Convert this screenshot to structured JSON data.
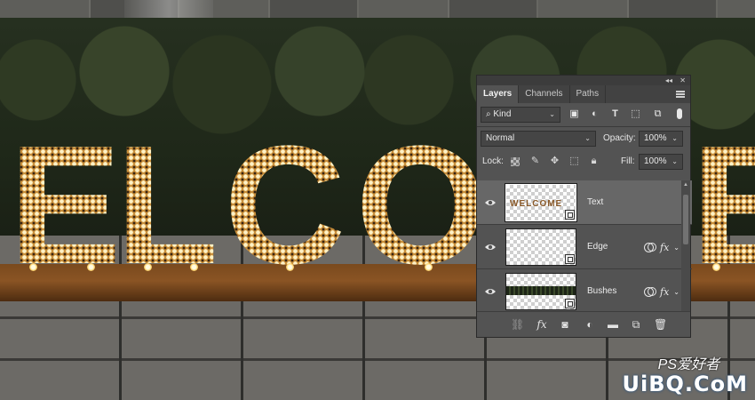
{
  "panel": {
    "tabs": [
      {
        "label": "Layers",
        "active": true
      },
      {
        "label": "Channels",
        "active": false
      },
      {
        "label": "Paths",
        "active": false
      }
    ],
    "filter": {
      "value": "Kind"
    },
    "blend_mode": {
      "value": "Normal"
    },
    "opacity": {
      "label": "Opacity:",
      "value": "100%"
    },
    "lock": {
      "label": "Lock:"
    },
    "fill": {
      "label": "Fill:",
      "value": "100%"
    },
    "layers": [
      {
        "name": "Text",
        "selected": true,
        "thumbnail_text": "WELCOME",
        "has_fx": false
      },
      {
        "name": "Edge",
        "selected": false,
        "has_fx": true
      },
      {
        "name": "Bushes",
        "selected": false,
        "has_fx": true
      }
    ]
  },
  "scene": {
    "sign_letters": [
      "E",
      "L",
      "C",
      "O",
      "E"
    ]
  },
  "watermark": {
    "text": "UiBQ.CoM",
    "top_text": "PS爱好者"
  },
  "colors": {
    "panel_bg": "#535353",
    "selected_layer": "#676767",
    "platform_wood": "#8a5424",
    "bulb_glow": "#fff2c6"
  }
}
